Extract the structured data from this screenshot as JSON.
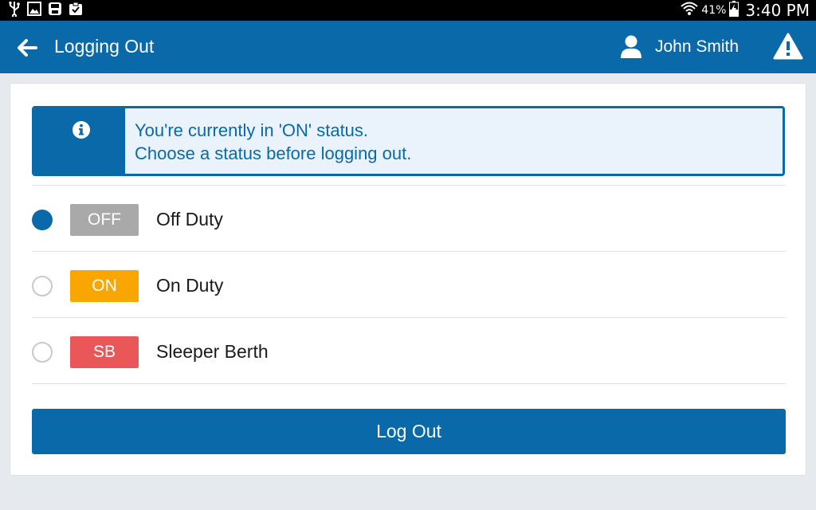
{
  "status_bar": {
    "icons": [
      "usb-icon",
      "image-icon",
      "save-icon",
      "clipboard-icon"
    ],
    "battery_percent": "41%",
    "time": "3:40 PM"
  },
  "header": {
    "title": "Logging Out",
    "user_name": "John Smith",
    "color": "#0a69a8"
  },
  "info_banner": {
    "line1": "You're currently in 'ON' status.",
    "line2": "Choose a status before logging out."
  },
  "statuses": [
    {
      "code": "OFF",
      "label": "Off Duty",
      "selected": true,
      "color": "#a9a9a9"
    },
    {
      "code": "ON",
      "label": "On Duty",
      "selected": false,
      "color": "#f9a602"
    },
    {
      "code": "SB",
      "label": "Sleeper Berth",
      "selected": false,
      "color": "#ea5758"
    }
  ],
  "logout_button": {
    "label": "Log Out"
  }
}
